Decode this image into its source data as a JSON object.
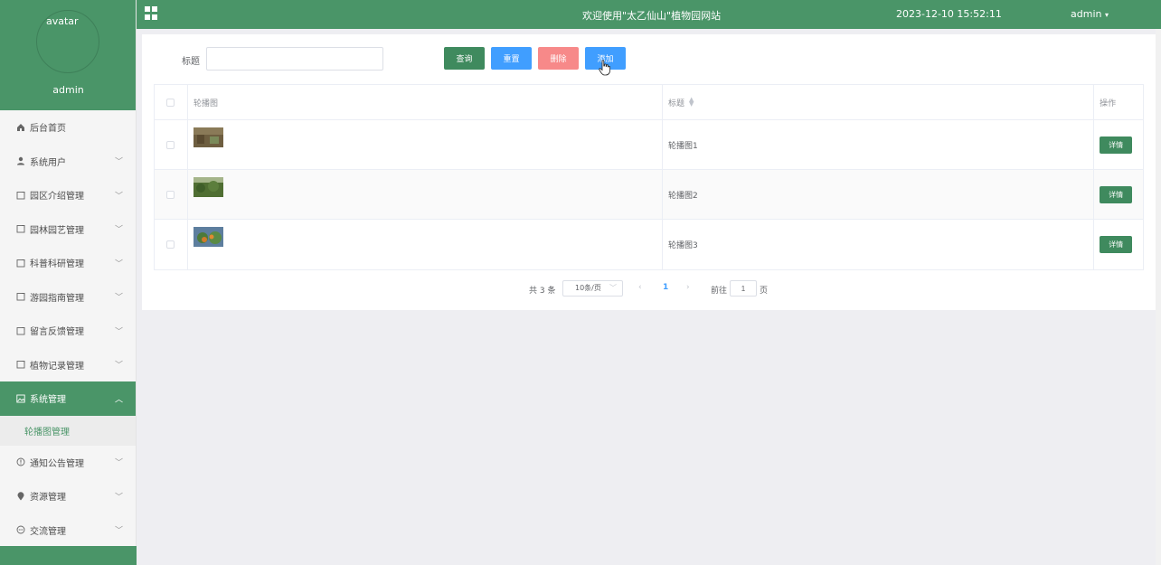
{
  "sidebar": {
    "avatar_alt": "avatar",
    "username": "admin",
    "items": [
      {
        "label": "后台首页",
        "icon": "home-icon",
        "expandable": false
      },
      {
        "label": "系统用户",
        "icon": "user-icon",
        "expandable": true
      },
      {
        "label": "园区介绍管理",
        "icon": "document-icon",
        "expandable": true
      },
      {
        "label": "园林园艺管理",
        "icon": "document-icon",
        "expandable": true
      },
      {
        "label": "科普科研管理",
        "icon": "document-icon",
        "expandable": true
      },
      {
        "label": "游园指南管理",
        "icon": "document-icon",
        "expandable": true
      },
      {
        "label": "留言反馈管理",
        "icon": "document-icon",
        "expandable": true
      },
      {
        "label": "植物记录管理",
        "icon": "document-icon",
        "expandable": true
      },
      {
        "label": "系统管理",
        "icon": "picture-icon",
        "expandable": true,
        "active": true
      },
      {
        "label": "通知公告管理",
        "icon": "info-icon",
        "expandable": true
      },
      {
        "label": "资源管理",
        "icon": "location-icon",
        "expandable": true
      },
      {
        "label": "交流管理",
        "icon": "chat-icon",
        "expandable": true
      }
    ],
    "submenu_active": "轮播图管理"
  },
  "header": {
    "title": "欢迎使用\"太乙仙山\"植物园网站",
    "datetime": "2023-12-10 15:52:11",
    "user": "admin"
  },
  "search": {
    "label": "标题",
    "value": "",
    "placeholder": ""
  },
  "buttons": {
    "query": "查询",
    "reset": "重置",
    "delete": "删除",
    "add": "添加"
  },
  "table": {
    "headers": {
      "image": "轮播图",
      "title": "标题",
      "operation": "操作"
    },
    "detail_label": "详情",
    "rows": [
      {
        "title": "轮播图1",
        "thumb_color": "#7a6a4a"
      },
      {
        "title": "轮播图2",
        "thumb_color": "#5c7a3c"
      },
      {
        "title": "轮播图3",
        "thumb_color": "#6a8a5a"
      }
    ]
  },
  "pagination": {
    "total": "共 3 条",
    "page_size": "10条/页",
    "current_page": "1",
    "goto_label": "前往",
    "goto_value": "1",
    "page_suffix": "页"
  },
  "colors": {
    "primary": "#4a9568",
    "blue": "#409eff",
    "danger": "#f78989"
  }
}
